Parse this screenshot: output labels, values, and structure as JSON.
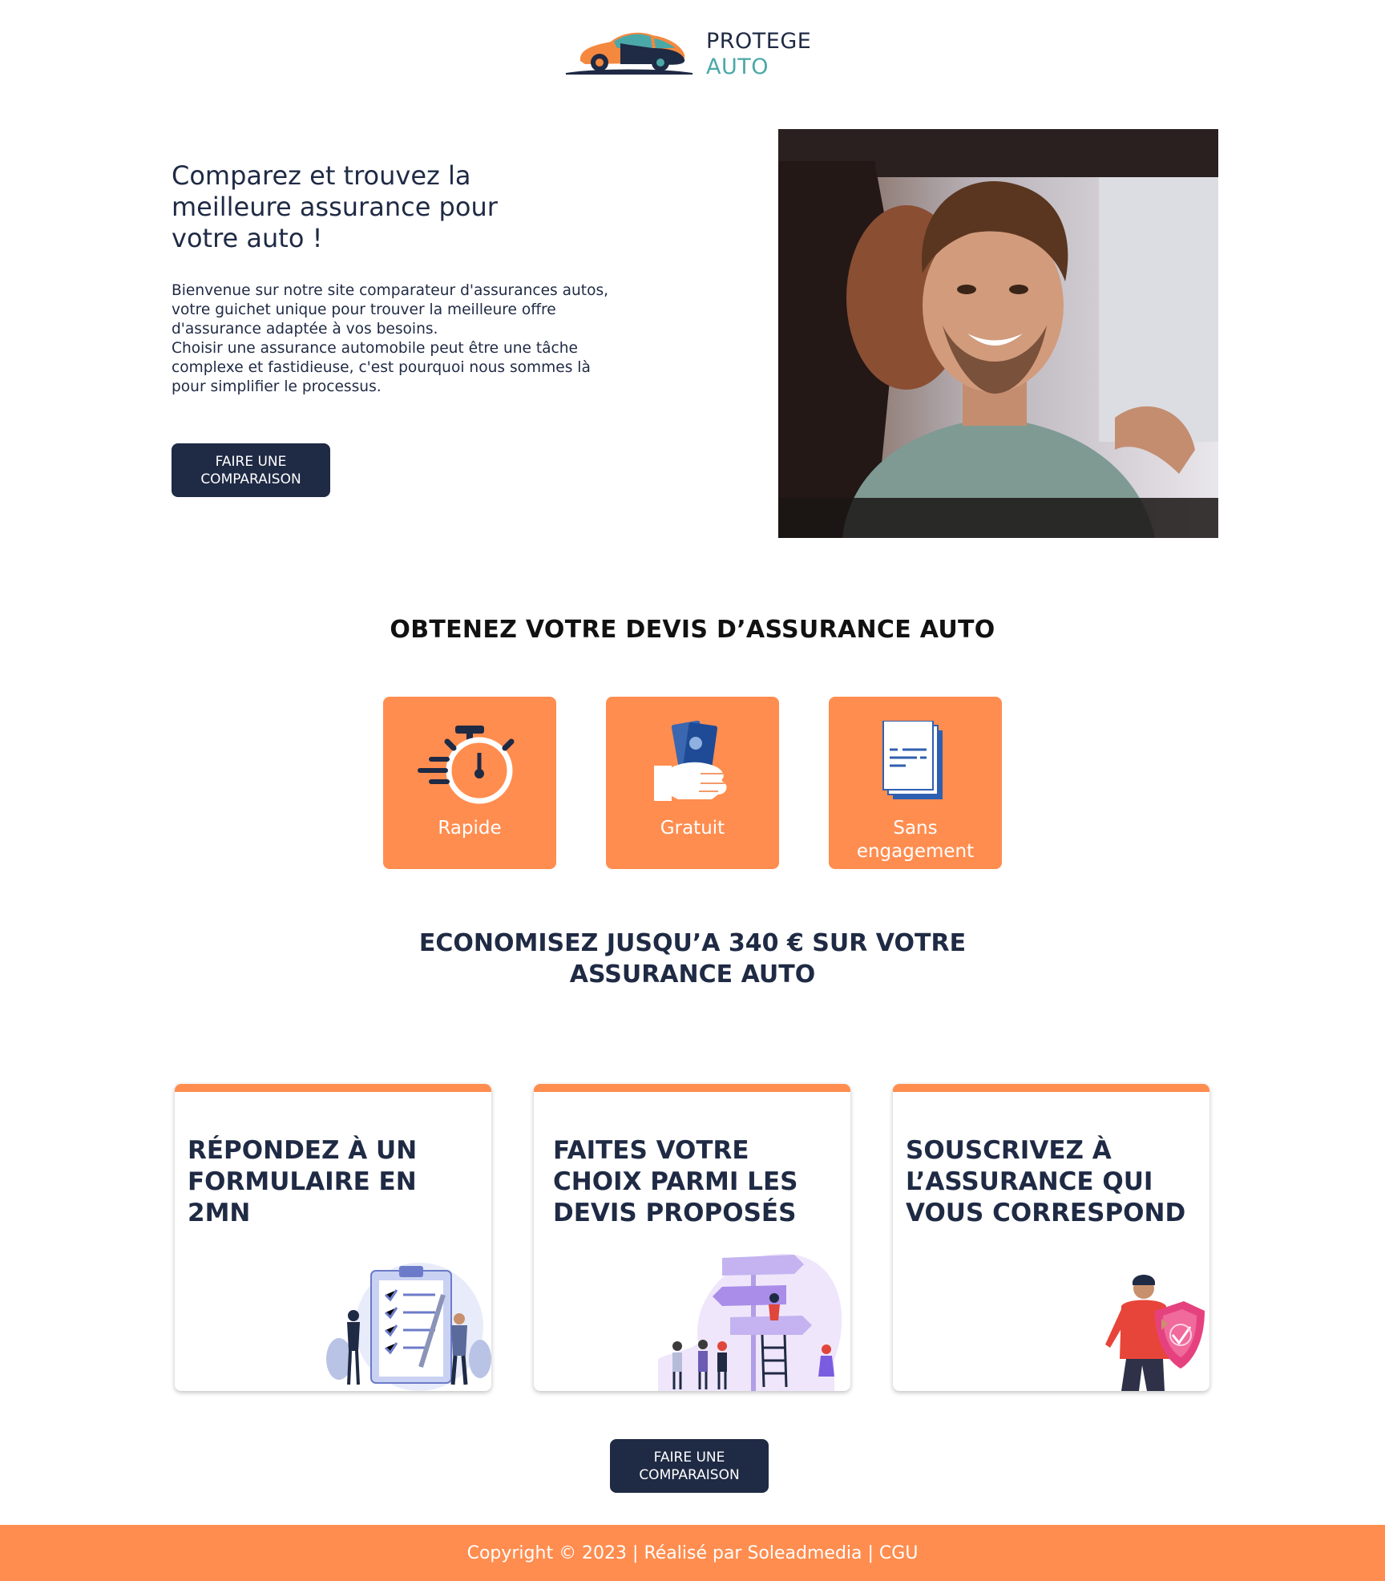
{
  "brand": {
    "name_line1": "PROTEGE",
    "name_line2": "AUTO",
    "logo_icon": "car-icon"
  },
  "hero": {
    "title": "Comparez et trouvez la meilleure assurance pour votre auto !",
    "paragraph1": "Bienvenue sur notre site comparateur d'assurances autos, votre guichet unique pour trouver la meilleure offre d'assurance adaptée à vos besoins.",
    "paragraph2": "Choisir une assurance automobile peut être une tâche complexe et fastidieuse, c'est pourquoi nous sommes là pour simplifier le processus.",
    "cta_label": "FAIRE UNE COMPARAISON"
  },
  "section_quote": {
    "title": "OBTENEZ VOTRE DEVIS D’ASSURANCE AUTO",
    "features": [
      {
        "label": "Rapide",
        "icon": "stopwatch-icon"
      },
      {
        "label": "Gratuit",
        "icon": "money-hand-icon"
      },
      {
        "label": "Sans engagement",
        "icon": "document-icon"
      }
    ]
  },
  "section_savings": {
    "title_line1": "ECONOMISEZ JUSQU’A 340 € SUR VOTRE",
    "title_line2": "ASSURANCE AUTO"
  },
  "steps": [
    {
      "title": "RÉPONDEZ À UN FORMULAIRE EN 2MN",
      "icon": "checklist-illustration"
    },
    {
      "title": "FAITES VOTRE CHOIX PARMI LES DEVIS PROPOSÉS",
      "icon": "signpost-illustration"
    },
    {
      "title": "SOUSCRIVEZ À L’ASSURANCE QUI VOUS CORRESPOND",
      "icon": "shield-person-illustration"
    }
  ],
  "bottom_cta_label": "FAIRE UNE COMPARAISON",
  "footer": {
    "text": "Copyright © 2023 | Réalisé par Soleadmedia | CGU"
  },
  "colors": {
    "navy": "#1f2a44",
    "orange": "#ff8d4f",
    "teal": "#4ba8a8"
  }
}
